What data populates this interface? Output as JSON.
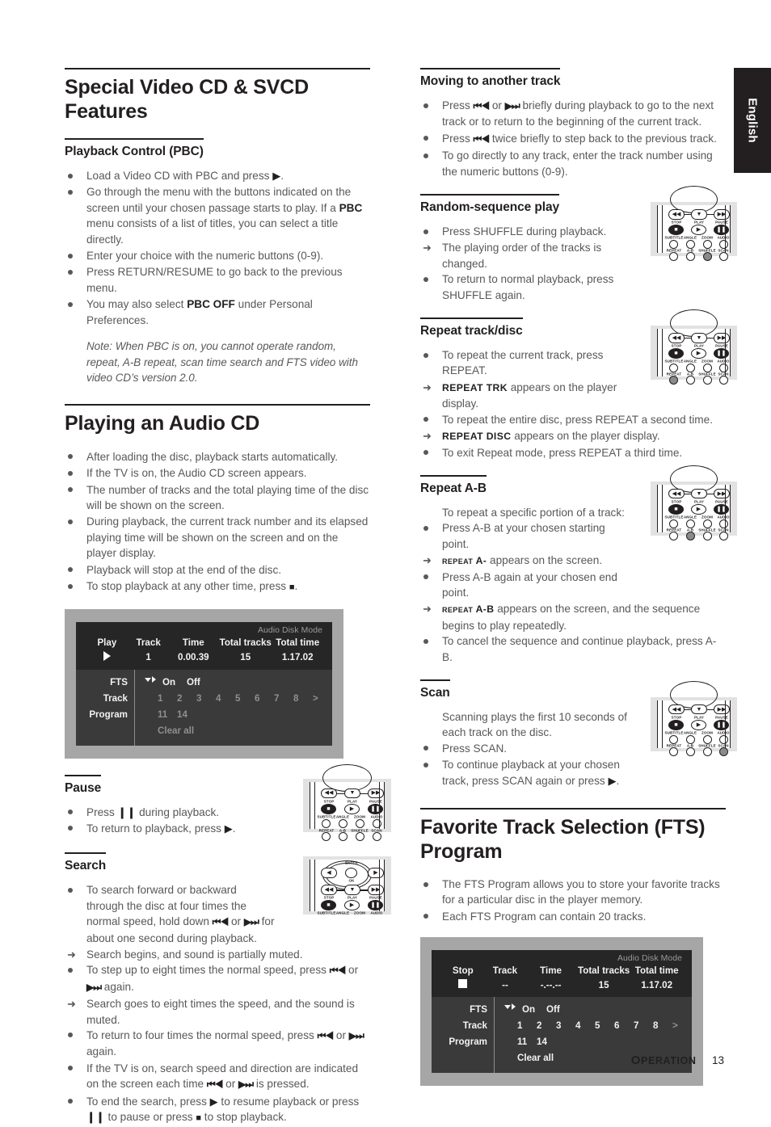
{
  "language_tab": "English",
  "footer": {
    "section": "PERATION",
    "section_cap": "O",
    "page": "13"
  },
  "left": {
    "title": "Special Video CD & SVCD Features",
    "pbc": {
      "heading": "Playback Control (PBC)",
      "items": [
        "Load a Video CD with PBC and press ▶.",
        "Go through the menu with the buttons indicated on the screen until your chosen passage starts to play. If a PBC menu consists of a list of titles, you can select a title directly.",
        "Enter your choice with the numeric buttons (0-9).",
        "Press RETURN/RESUME to go back to the previous menu.",
        "You may also select PBC OFF under Personal Preferences."
      ],
      "item1_pre": "Load a Video CD with PBC and press ",
      "item1_post": ".",
      "item2_a": "Go through the menu with the buttons indicated on the screen until your chosen passage starts to play. If a ",
      "item2_b": "PBC",
      "item2_c": " menu consists of a list of titles, you can select a title directly.",
      "item3": "Enter your choice with the numeric buttons (0-9).",
      "item4": "Press RETURN/RESUME to go back to the previous menu.",
      "item5_a": "You may also select ",
      "item5_b": "PBC OFF",
      "item5_c": " under Personal Preferences.",
      "note": "Note: When PBC is on, you cannot operate random, repeat, A-B repeat, scan time search and FTS video with video CD’s version 2.0."
    },
    "audiocd": {
      "title": "Playing an Audio CD",
      "items": [
        "After loading the disc, playback starts automatically.",
        "If the TV is on, the Audio CD screen appears.",
        "The number of tracks and the total playing time of the disc will be shown on the screen.",
        "During playback, the current track number and its elapsed playing time will be shown on the screen and on the player display.",
        "Playback will stop at the end of the disc.",
        "To stop playback at any other time, press ■."
      ],
      "item6_pre": "To stop playback at any other time, press ",
      "item6_post": "."
    },
    "pause": {
      "heading": "Pause",
      "item1_pre": "Press ",
      "item1_post": " during playback.",
      "item2_pre": "To return to playback, press ",
      "item2_post": "."
    },
    "search": {
      "heading": "Search",
      "l1_a": "To search forward or backward through the disc at four times the normal speed, hold down ",
      "l1_b": " or ",
      "l1_c": " for about one second during playback.",
      "l1_arrow": "Search begins, and sound is partially muted.",
      "l2_a": "To step up to eight times the normal speed, press ",
      "l2_b": " or ",
      "l2_c": " again.",
      "l2_arrow": "Search goes to eight times the speed, and the sound is muted.",
      "l3_a": "To return to four times the normal speed, press ",
      "l3_b": " or ",
      "l3_c": " again.",
      "l4_a": "If the TV is on, search speed and direction are indicated on the screen each time ",
      "l4_b": " or ",
      "l4_c": " is pressed.",
      "l5_a": "To end the search, press ",
      "l5_b": " to resume playback or press ",
      "l5_c": " to pause or press ",
      "l5_d": " to stop playback."
    }
  },
  "right": {
    "moving": {
      "heading": "Moving to another track",
      "i1_a": "Press ",
      "i1_b": " or ",
      "i1_c": " briefly during playback to go to the next track or to return to the beginning of the current track.",
      "i2_a": "Press ",
      "i2_b": " twice briefly to step back to the previous track.",
      "i3": "To go directly to any track, enter the track number using the numeric buttons (0-9)."
    },
    "random": {
      "heading": "Random-sequence play",
      "i1": "Press SHUFFLE during playback.",
      "i1_arrow": "The playing order of the tracks is changed.",
      "i2": "To return to normal playback, press SHUFFLE again."
    },
    "repeat": {
      "heading": "Repeat track/disc",
      "i1": "To repeat the current track, press REPEAT.",
      "i1_arrow_sc": "REPEAT TRK",
      "i1_arrow_rest": " appears on the player display.",
      "i2": "To repeat the entire disc, press REPEAT a second time.",
      "i2_arrow_sc": "REPEAT DISC",
      "i2_arrow_rest": " appears on the player display.",
      "i3": "To exit Repeat mode, press REPEAT a third time."
    },
    "repeatab": {
      "heading": "Repeat A-B",
      "intro": "To repeat a specific portion of a track:",
      "i1": "Press A-B at your chosen starting point.",
      "i1_arrow_sc": "repeat A-",
      "i1_arrow_rest": " appears on the screen.",
      "i2": "Press A-B again at your chosen end point.",
      "i2_arrow_sc": "repeat A-B",
      "i2_arrow_rest": " appears on the screen, and the sequence begins to play repeatedly.",
      "i3": "To cancel the sequence and continue playback, press A-B."
    },
    "scan": {
      "heading": "Scan",
      "intro": "Scanning plays the first 10 seconds of each track on the disc.",
      "i1": "Press SCAN.",
      "i2_a": "To continue playback at your chosen track, press SCAN again or press ",
      "i2_b": "."
    },
    "fts": {
      "title": "Favorite Track Selection (FTS) Program",
      "i1": "The FTS Program allows you to store your favorite tracks for a particular disc in the player memory.",
      "i2": "Each FTS Program can contain 20 tracks."
    }
  },
  "osd_play": {
    "mode_title": "Audio Disk Mode",
    "headers": [
      "Play",
      "Track",
      "Time",
      "Total tracks",
      "Total time"
    ],
    "values": [
      "play-symbol",
      "1",
      "0.00.39",
      "15",
      "1.17.02"
    ],
    "fts_label": "FTS",
    "fts_on": "On",
    "fts_off": "Off",
    "track_label": "Track",
    "program_label": "Program",
    "track_numbers": [
      "1",
      "2",
      "3",
      "4",
      "5",
      "6",
      "7",
      "8",
      ">"
    ],
    "program_numbers": [
      "11",
      "14"
    ],
    "clear_all": "Clear all",
    "state": "dim"
  },
  "osd_stop": {
    "mode_title": "Audio Disk Mode",
    "headers": [
      "Stop",
      "Track",
      "Time",
      "Total tracks",
      "Total time"
    ],
    "values": [
      "stop-symbol",
      "--",
      "-.--.--",
      "15",
      "1.17.02"
    ],
    "fts_label": "FTS",
    "fts_on": "On",
    "fts_off": "Off",
    "track_label": "Track",
    "program_label": "Program",
    "track_numbers": [
      "1",
      "2",
      "3",
      "4",
      "5",
      "6",
      "7",
      "8",
      ">"
    ],
    "program_numbers": [
      "11",
      "14"
    ],
    "clear_all": "Clear all",
    "state": "bright"
  },
  "remote": {
    "row_labels_top": [
      "STOP",
      "PLAY",
      "PAUSE"
    ],
    "row_labels_mid": [
      "SUBTITLE",
      "ANGLE",
      "ZOOM",
      "AUDIO"
    ],
    "row_labels_bot": [
      "REPEAT",
      "A-B",
      "SHUFFLE",
      "SCAN"
    ],
    "enter": "ENTER",
    "ok": "OK"
  },
  "glyphs": {
    "play": "▶",
    "stop": "■",
    "pause": "❙❙",
    "prev": "⏮◀",
    "next": "▶⏭",
    "arrow": "➜"
  },
  "colors": {
    "ink": "#231f20",
    "body_text": "#58585a",
    "osd_bg": "#3a3a3a",
    "osd_header_bg": "#262626",
    "osd_frame": "#a6a6a6",
    "remote_bg": "#e2e2e2"
  }
}
